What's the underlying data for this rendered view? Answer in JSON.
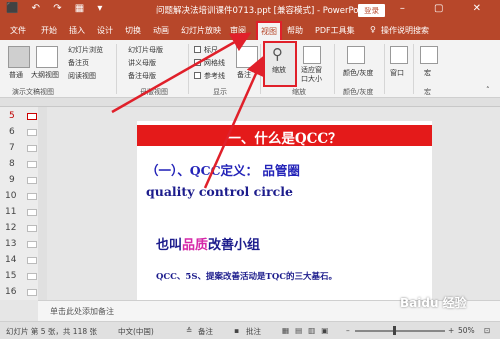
{
  "titlebar": {
    "quick_access": "⬛ ↶ ↷ ▦ ▾",
    "document_title": "问题解决法培训课件0713.ppt [兼容模式] - PowerPoint",
    "login_label": "登录",
    "window_controls": "▭ – ▢ ✕"
  },
  "tabs": [
    "文件",
    "开始",
    "插入",
    "设计",
    "切换",
    "动画",
    "幻灯片放映",
    "审阅",
    "视图",
    "帮助",
    "PDF工具集",
    "操作说明搜索"
  ],
  "active_tab": "视图",
  "ribbon": {
    "views": {
      "normal": "普通",
      "outline": "大纲视图",
      "sorter": "幻灯片浏览",
      "notes_page": "备注页",
      "reading": "阅读视图",
      "group_label": "演示文稿视图"
    },
    "master": {
      "slide_master": "幻灯片母版",
      "handout_master": "讲义母版",
      "notes_master": "备注母版",
      "group_label": "母版视图"
    },
    "show": {
      "ruler": "标尺",
      "gridlines": "网格线",
      "guides": "参考线",
      "notes": "备注",
      "group_label": "显示"
    },
    "zoom": {
      "zoom": "缩放",
      "fit_window": "适应窗口大小",
      "group_label": "缩放"
    },
    "color": {
      "color_gray": "颜色/灰度",
      "group_label": "颜色/灰度"
    },
    "window": {
      "window": "窗口"
    },
    "macro": {
      "macro": "宏",
      "group_label": "宏"
    }
  },
  "thumbnails": [
    "5",
    "6",
    "7",
    "8",
    "9",
    "10",
    "11",
    "12",
    "13",
    "14",
    "15",
    "16"
  ],
  "current_slide": "5",
  "slide": {
    "title": "一、什么是QCC？",
    "line1_prefix": "（一）、QCC定义：",
    "line1_suffix": "品管圈",
    "line2": "quality control circle",
    "line3_a": "也叫",
    "line3_highlight": "品质",
    "line3_b": "改善小组",
    "line4": "QCC、5S、提案改善活动是TQC的三大基石。"
  },
  "notes_placeholder": "单击此处添加备注",
  "statusbar": {
    "slide_info": "幻灯片 第 5 张，共 118 张",
    "language": "中文(中国)",
    "notes_btn": "备注",
    "comments_btn": "批注",
    "zoom_level": "50%"
  },
  "watermark": "Baidu 经验",
  "colors": {
    "accent": "#b7472a",
    "highlight_box": "#e0202a",
    "slide_title_bar": "#e41a1a"
  }
}
